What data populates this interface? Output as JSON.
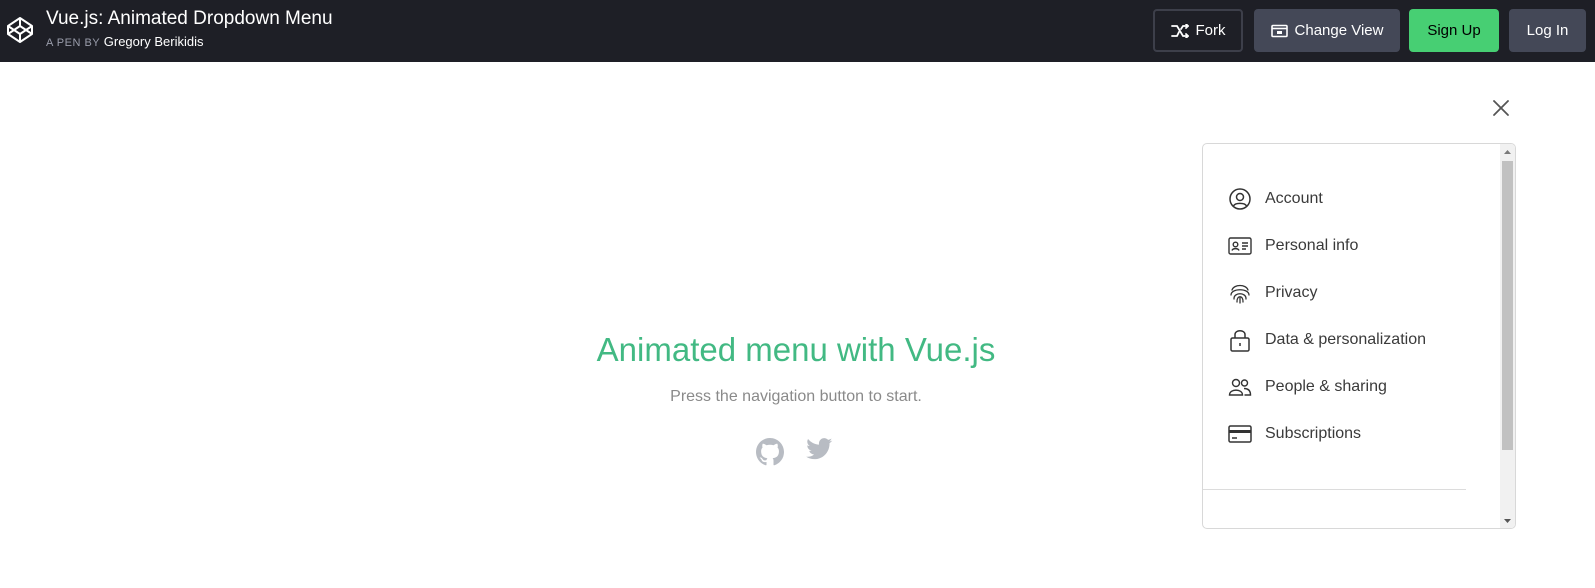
{
  "header": {
    "title": "Vue.js: Animated Dropdown Menu",
    "by_prefix": "A PEN BY",
    "author": "Gregory Berikidis",
    "fork_label": "Fork",
    "change_view_label": "Change View",
    "signup_label": "Sign Up",
    "login_label": "Log In"
  },
  "main": {
    "title": "Animated menu with Vue.js",
    "subtitle": "Press the navigation button to start.",
    "icons": [
      "github-icon",
      "twitter-icon"
    ]
  },
  "menu": {
    "items": [
      {
        "label": "Account",
        "icon": "account-circle-icon"
      },
      {
        "label": "Personal info",
        "icon": "id-card-icon"
      },
      {
        "label": "Privacy",
        "icon": "fingerprint-icon"
      },
      {
        "label": "Data & personalization",
        "icon": "lock-icon"
      },
      {
        "label": "People & sharing",
        "icon": "people-icon"
      },
      {
        "label": "Subscriptions",
        "icon": "credit-card-icon"
      }
    ]
  },
  "colors": {
    "topbar": "#1e1f26",
    "signup": "#47cf73",
    "accent": "#42b983",
    "button": "#444857"
  }
}
